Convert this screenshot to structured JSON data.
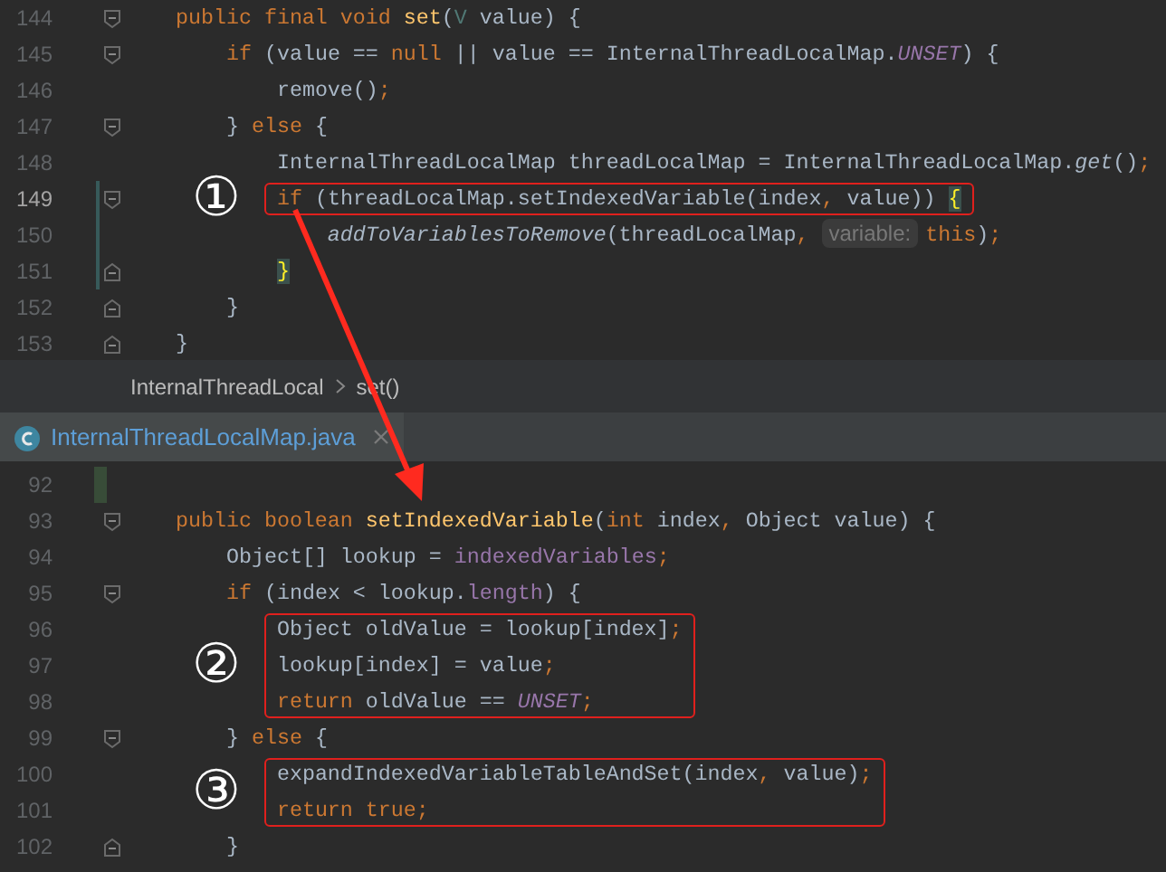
{
  "editor_top": {
    "lines": [
      {
        "kind": "line",
        "number": "144",
        "fold": {
          "kind": "start"
        },
        "tokens": [
          {
            "kind": "kw",
            "text": "    public final void "
          },
          {
            "kind": "decl",
            "text": "set"
          },
          {
            "kind": "plain",
            "text": "("
          },
          {
            "kind": "tparam",
            "text": "V"
          },
          {
            "kind": "plain",
            "text": " value) {"
          }
        ]
      },
      {
        "kind": "line",
        "number": "145",
        "fold": {
          "kind": "start"
        },
        "tokens": [
          {
            "kind": "kw",
            "text": "        if "
          },
          {
            "kind": "plain",
            "text": "(value == "
          },
          {
            "kind": "kw",
            "text": "null"
          },
          {
            "kind": "plain",
            "text": " || value == InternalThreadLocalMap."
          },
          {
            "kind": "const",
            "text": "UNSET"
          },
          {
            "kind": "plain",
            "text": ") {"
          }
        ]
      },
      {
        "kind": "line",
        "number": "146",
        "tokens": [
          {
            "kind": "plain",
            "text": "            remove()"
          },
          {
            "kind": "kw",
            "text": ";"
          }
        ]
      },
      {
        "kind": "line",
        "number": "147",
        "fold": {
          "kind": "start"
        },
        "tokens": [
          {
            "kind": "plain",
            "text": "        } "
          },
          {
            "kind": "kw",
            "text": "else"
          },
          {
            "kind": "plain",
            "text": " {"
          }
        ]
      },
      {
        "kind": "line",
        "number": "148",
        "tokens": [
          {
            "kind": "plain",
            "text": "            InternalThreadLocalMap threadLocalMap = InternalThreadLocalMap."
          },
          {
            "kind": "static",
            "text": "get"
          },
          {
            "kind": "plain",
            "text": "()"
          },
          {
            "kind": "kw",
            "text": ";"
          }
        ]
      },
      {
        "kind": "callout",
        "badge": "①",
        "lines": [
          {
            "kind": "line",
            "number": "149",
            "current": true,
            "fold": {
              "kind": "start"
            },
            "change": {
              "kind": "modified"
            },
            "tokens": [
              {
                "kind": "kw",
                "text": "            if "
              },
              {
                "kind": "plain",
                "text": "(threadLocalMap.setIndexedVariable(index"
              },
              {
                "kind": "kw",
                "text": ","
              },
              {
                "kind": "plain",
                "text": " value)) "
              },
              {
                "kind": "brace",
                "text": "{"
              }
            ]
          }
        ]
      },
      {
        "kind": "line",
        "number": "150",
        "change": {
          "kind": "modified"
        },
        "tokens": [
          {
            "kind": "static",
            "text": "                addToVariablesToRemove"
          },
          {
            "kind": "plain",
            "text": "(threadLocalMap"
          },
          {
            "kind": "kw",
            "text": ", "
          },
          {
            "kind": "hint",
            "text": "variable:"
          },
          {
            "kind": "kw",
            "text": "this"
          },
          {
            "kind": "plain",
            "text": ")"
          },
          {
            "kind": "kw",
            "text": ";"
          }
        ]
      },
      {
        "kind": "line",
        "number": "151",
        "fold": {
          "kind": "end"
        },
        "change": {
          "kind": "modified"
        },
        "tokens": [
          {
            "kind": "brace",
            "text": "            }"
          }
        ]
      },
      {
        "kind": "line",
        "number": "152",
        "fold": {
          "kind": "end"
        },
        "tokens": [
          {
            "kind": "plain",
            "text": "        }"
          }
        ]
      },
      {
        "kind": "line",
        "number": "153",
        "fold": {
          "kind": "end"
        },
        "tokens": [
          {
            "kind": "plain",
            "text": "    }"
          }
        ]
      }
    ]
  },
  "breadcrumbs": [
    "InternalThreadLocal",
    "set()"
  ],
  "tabs": [
    {
      "label": "InternalThreadLocalMap.java",
      "selected": true
    }
  ],
  "editor_bottom": {
    "lines": [
      {
        "kind": "line",
        "number": "92",
        "change": {
          "kind": "added"
        }
      },
      {
        "kind": "line",
        "number": "93",
        "fold": {
          "kind": "start"
        },
        "tokens": [
          {
            "kind": "kw",
            "text": "    public boolean "
          },
          {
            "kind": "decl",
            "text": "setIndexedVariable"
          },
          {
            "kind": "plain",
            "text": "("
          },
          {
            "kind": "kw",
            "text": "int"
          },
          {
            "kind": "plain",
            "text": " index"
          },
          {
            "kind": "kw",
            "text": ","
          },
          {
            "kind": "plain",
            "text": " Object value) {"
          }
        ]
      },
      {
        "kind": "line",
        "number": "94",
        "tokens": [
          {
            "kind": "plain",
            "text": "        Object[] lookup = "
          },
          {
            "kind": "field",
            "text": "indexedVariables"
          },
          {
            "kind": "kw",
            "text": ";"
          }
        ]
      },
      {
        "kind": "line",
        "number": "95",
        "fold": {
          "kind": "start"
        },
        "tokens": [
          {
            "kind": "kw",
            "text": "        if "
          },
          {
            "kind": "plain",
            "text": "(index < lookup."
          },
          {
            "kind": "field",
            "text": "length"
          },
          {
            "kind": "plain",
            "text": ") {"
          }
        ]
      },
      {
        "kind": "callout",
        "badge": "②",
        "lines": [
          {
            "kind": "line",
            "number": "96",
            "tokens": [
              {
                "kind": "plain",
                "text": "            Object oldValue = lookup[index]"
              },
              {
                "kind": "kw",
                "text": ";"
              }
            ]
          },
          {
            "kind": "line",
            "number": "97",
            "tokens": [
              {
                "kind": "plain",
                "text": "            lookup[index] = value"
              },
              {
                "kind": "kw",
                "text": ";"
              }
            ]
          },
          {
            "kind": "line",
            "number": "98",
            "tokens": [
              {
                "kind": "kw",
                "text": "            return "
              },
              {
                "kind": "plain",
                "text": "oldValue == "
              },
              {
                "kind": "const",
                "text": "UNSET"
              },
              {
                "kind": "kw",
                "text": ";"
              }
            ]
          }
        ]
      },
      {
        "kind": "line",
        "number": "99",
        "fold": {
          "kind": "start"
        },
        "tokens": [
          {
            "kind": "plain",
            "text": "        } "
          },
          {
            "kind": "kw",
            "text": "else"
          },
          {
            "kind": "plain",
            "text": " {"
          }
        ]
      },
      {
        "kind": "callout",
        "badge": "③",
        "lines": [
          {
            "kind": "line",
            "number": "100",
            "tokens": [
              {
                "kind": "plain",
                "text": "            expandIndexedVariableTableAndSet(index"
              },
              {
                "kind": "kw",
                "text": ","
              },
              {
                "kind": "plain",
                "text": " value)"
              },
              {
                "kind": "kw",
                "text": ";"
              }
            ]
          },
          {
            "kind": "line",
            "number": "101",
            "tokens": [
              {
                "kind": "kw",
                "text": "            return true;"
              }
            ]
          }
        ]
      },
      {
        "kind": "line",
        "number": "102",
        "fold": {
          "kind": "end"
        },
        "tokens": [
          {
            "kind": "plain",
            "text": "        }"
          }
        ]
      }
    ]
  }
}
